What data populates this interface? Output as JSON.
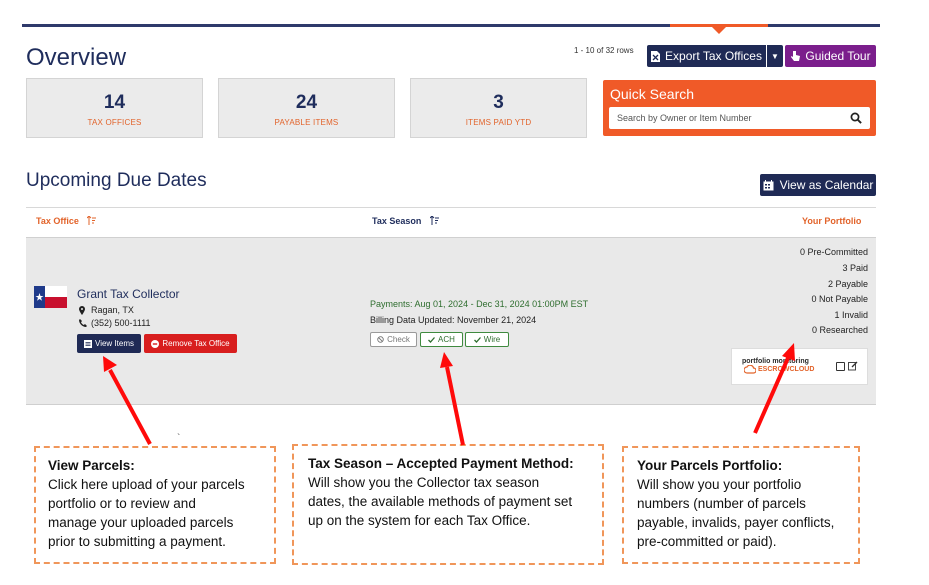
{
  "page": {
    "title": "Overview",
    "rows_count": "1 - 10 of 32 rows"
  },
  "toolbar": {
    "export_label": "Export Tax Offices",
    "guided_tour_label": "Guided Tour",
    "view_calendar_label": "View as Calendar"
  },
  "stats": [
    {
      "value": "14",
      "label": "TAX OFFICES"
    },
    {
      "value": "24",
      "label": "PAYABLE ITEMS"
    },
    {
      "value": "3",
      "label": "ITEMS PAID YTD"
    }
  ],
  "quick_search": {
    "title": "Quick Search",
    "placeholder": "Search by Owner or Item Number"
  },
  "section": {
    "title": "Upcoming Due Dates"
  },
  "table": {
    "headers": {
      "tax_office": "Tax Office",
      "tax_season": "Tax Season",
      "portfolio": "Your Portfolio"
    },
    "row": {
      "office_name": "Grant Tax Collector",
      "city": "Ragan, TX",
      "phone": "(352) 500-1111",
      "view_items_label": "View Items",
      "remove_label": "Remove Tax Office",
      "payments": "Payments: Aug 01, 2024 - Dec 31, 2024 01:00PM EST",
      "billing": "Billing Data Updated: November 21, 2024",
      "methods": {
        "check": "Check",
        "ach": "ACH",
        "wire": "Wire"
      },
      "portfolio": [
        "0 Pre-Committed",
        "3 Paid",
        "2 Payable",
        "0 Not Payable",
        "1 Invalid",
        "0 Researched"
      ],
      "logo": {
        "line1": "portfolio monitoring",
        "line2": "ESCROWCLOUD"
      }
    }
  },
  "callouts": [
    {
      "title": "View Parcels:",
      "lines": [
        "Click here upload of your parcels",
        "portfolio or to review and",
        "manage your uploaded parcels",
        "prior to submitting a payment."
      ]
    },
    {
      "title": "Tax Season – Accepted Payment Method:",
      "lines": [
        "Will show you the Collector tax season",
        "dates, the available methods of payment set",
        "up on the system for each Tax Office."
      ]
    },
    {
      "title": "Your Parcels Portfolio:",
      "lines": [
        "Will show you your portfolio",
        "numbers (number of parcels",
        "payable, invalids, payer conflicts,",
        "pre-committed or paid)."
      ]
    }
  ],
  "colors": {
    "navy": "#1f2a55",
    "orange": "#f05a28",
    "purple": "#7b1e8c",
    "red": "#d81e1e",
    "arrow": "#ff0a0a"
  },
  "icons": [
    "file-excel-icon",
    "hand-pointer-icon",
    "calendar-icon",
    "search-icon",
    "sort-icon",
    "texas-flag-icon",
    "map-pin-icon",
    "phone-icon",
    "list-icon",
    "minus-circle-icon",
    "ban-icon",
    "check-icon",
    "edit-icon"
  ]
}
